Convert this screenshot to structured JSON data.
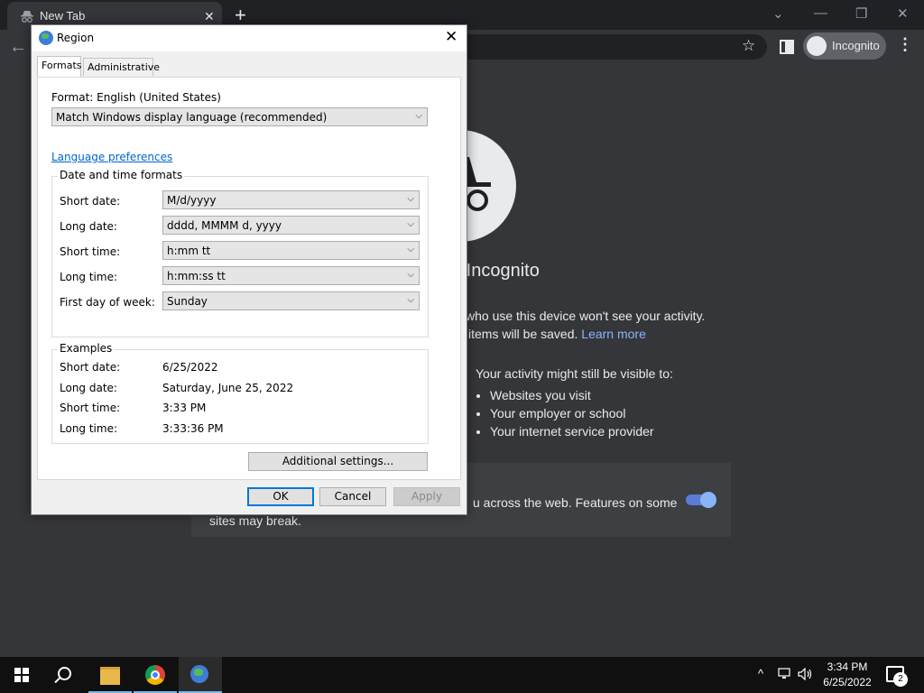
{
  "browser": {
    "tab_title": "New Tab",
    "tab_close": "✕",
    "new_tab": "+",
    "window_controls": {
      "chevron": "⌄",
      "minimize": "—",
      "restore": "❐",
      "close": "✕"
    },
    "back": "←",
    "star": "☆",
    "incognito_label": "Incognito",
    "menu": "⋮"
  },
  "ntp": {
    "heading_partial": "e Incognito",
    "line1_partial": "who use this device won't see your activity.",
    "line2_partial": "items will be saved.",
    "learn_more": "Learn more",
    "visible_to_heading": "Your activity might still be visible to:",
    "visible_to_items": [
      "Websites you visit",
      "Your employer or school",
      "Your internet service provider"
    ],
    "cookie_text_line1": "u across the web. Features on some",
    "cookie_text_line2": "sites may break."
  },
  "dialog": {
    "title": "Region",
    "close": "✕",
    "tabs": [
      "Formats",
      "Administrative"
    ],
    "format_label": "Format: English (United States)",
    "format_value": "Match Windows display language (recommended)",
    "language_link": "Language preferences",
    "dt_group_title": "Date and time formats",
    "dt_rows": [
      {
        "label": "Short date:",
        "value": "M/d/yyyy"
      },
      {
        "label": "Long date:",
        "value": "dddd, MMMM d, yyyy"
      },
      {
        "label": "Short time:",
        "value": "h:mm tt"
      },
      {
        "label": "Long time:",
        "value": "h:mm:ss tt"
      },
      {
        "label": "First day of week:",
        "value": "Sunday"
      }
    ],
    "examples_title": "Examples",
    "examples": [
      {
        "label": "Short date:",
        "value": "6/25/2022"
      },
      {
        "label": "Long date:",
        "value": "Saturday, June 25, 2022"
      },
      {
        "label": "Short time:",
        "value": "3:33 PM"
      },
      {
        "label": "Long time:",
        "value": "3:33:36 PM"
      }
    ],
    "additional_settings": "Additional settings...",
    "ok": "OK",
    "cancel": "Cancel",
    "apply": "Apply"
  },
  "taskbar": {
    "time": "3:34 PM",
    "date": "6/25/2022",
    "tray_chevron": "^",
    "notification_count": "2"
  }
}
